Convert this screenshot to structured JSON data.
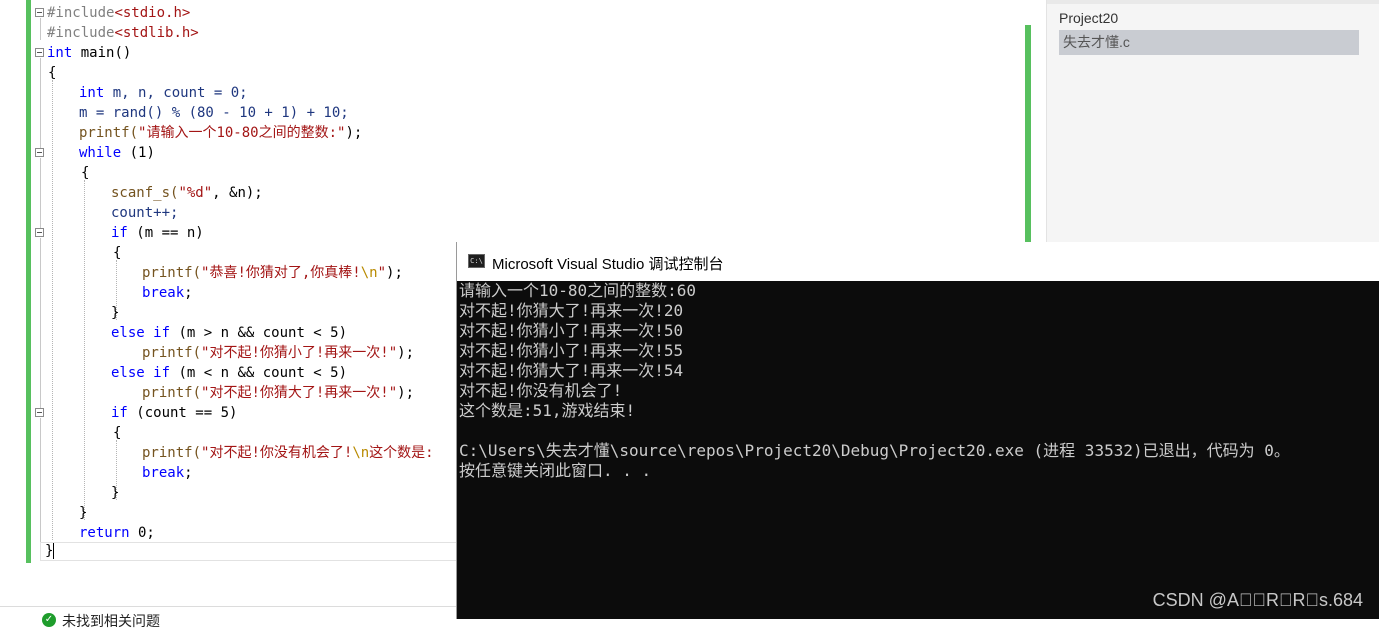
{
  "editor": {
    "lines": [
      [
        "#include",
        "<stdio.h>"
      ],
      [
        "#include",
        "<stdlib.h>"
      ],
      [
        "int",
        " main()"
      ],
      [
        "{"
      ],
      [
        "int",
        " m, n, count = 0;"
      ],
      [
        "m = rand() % (80 - 10 + 1) + 10;"
      ],
      [
        "printf(",
        "\"请输入一个10-80之间的整数:\"",
        ");"
      ],
      [
        "while",
        " (1)"
      ],
      [
        "{"
      ],
      [
        "scanf_s(",
        "\"%d\"",
        ", &n);"
      ],
      [
        "count++;"
      ],
      [
        "if",
        " (m == n)"
      ],
      [
        "{"
      ],
      [
        "printf(",
        "\"恭喜!你猜对了,你真棒!",
        "\\n",
        "\"",
        ");"
      ],
      [
        "break",
        ";"
      ],
      [
        "}"
      ],
      [
        "else",
        " ",
        "if",
        " (m > n && count < 5)"
      ],
      [
        "printf(",
        "\"对不起!你猜小了!再来一次!\"",
        ");"
      ],
      [
        "else",
        " ",
        "if",
        " (m < n && count < 5)"
      ],
      [
        "printf(",
        "\"对不起!你猜大了!再来一次!\"",
        ");"
      ],
      [
        "if",
        " (count == 5)"
      ],
      [
        "{"
      ],
      [
        "printf(",
        "\"对不起!你没有机会了!",
        "\\n",
        "这个数是:"
      ],
      [
        "break",
        ";"
      ],
      [
        "}"
      ],
      [
        "}"
      ],
      [
        "return",
        " 0;"
      ],
      [
        "}"
      ]
    ]
  },
  "solution_explorer": {
    "project": "Project20",
    "file": "失去才懂.c"
  },
  "status_bar": {
    "message": "未找到相关问题"
  },
  "console": {
    "title": "Microsoft Visual Studio 调试控制台",
    "icon_text": "C:\\",
    "lines": [
      "请输入一个10-80之间的整数:60",
      "对不起!你猜大了!再来一次!20",
      "对不起!你猜小了!再来一次!50",
      "对不起!你猜小了!再来一次!55",
      "对不起!你猜大了!再来一次!54",
      "对不起!你没有机会了!",
      "这个数是:51,游戏结束!",
      "",
      "C:\\Users\\失去才懂\\source\\repos\\Project20\\Debug\\Project20.exe (进程 33532)已退出，代码为 0。",
      "按任意键关闭此窗口. . ."
    ],
    "watermark": "CSDN @A\u0000\u0000R\u0000R\u0000s.684"
  }
}
